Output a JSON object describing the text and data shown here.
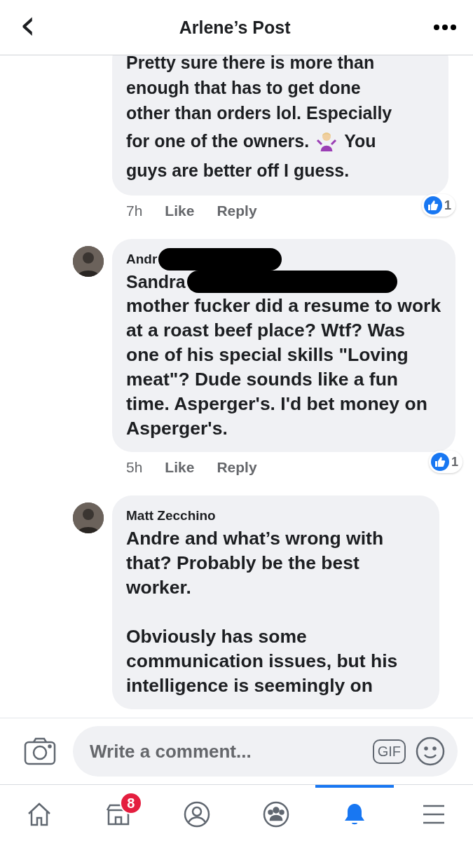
{
  "header": {
    "back": "‹",
    "title": "Arlene’s Post"
  },
  "comments": [
    {
      "lines": [
        {
          "kind": "text",
          "text": "Pretty sure there is more than"
        },
        {
          "kind": "text",
          "text": "enough that has to get done"
        },
        {
          "kind": "text",
          "text": "other than orders lol. Especially"
        },
        {
          "kind": "emoji",
          "before": "for one of the owners.",
          "after": "You"
        },
        {
          "kind": "text",
          "text": "guys are better off I guess."
        }
      ],
      "time": "7h",
      "like": "Like",
      "reply": "Reply",
      "reactions": "1"
    },
    {
      "author": "Andr",
      "author_redacted": true,
      "mention": {
        "text": "Sandra",
        "redacted": true
      },
      "paragraphs": [
        "mother fucker did a resume to work at a roast beef place? Wtf? Was one of his special skills \"Loving meat\"? Dude sounds like a fun time. Asperger's. I'd bet money on Asperger's."
      ],
      "time": "5h",
      "like": "Like",
      "reply": "Reply",
      "reactions": "1"
    },
    {
      "author": "Matt Zecchino",
      "paragraphs": [
        "**Andre** and what’s wrong with that? Probably be the best worker.",
        "Obviously has some communication issues, but his intelligence is seemingly on"
      ]
    }
  ],
  "composer": {
    "placeholder": "Write a comment...",
    "gif": "GIF"
  },
  "tabs": [
    {
      "kind": "home",
      "selected": false
    },
    {
      "kind": "marketplace",
      "selected": false,
      "badge": "8"
    },
    {
      "kind": "profile",
      "selected": false
    },
    {
      "kind": "groups",
      "selected": false
    },
    {
      "kind": "notifications",
      "selected": true
    },
    {
      "kind": "menu",
      "selected": false
    }
  ]
}
